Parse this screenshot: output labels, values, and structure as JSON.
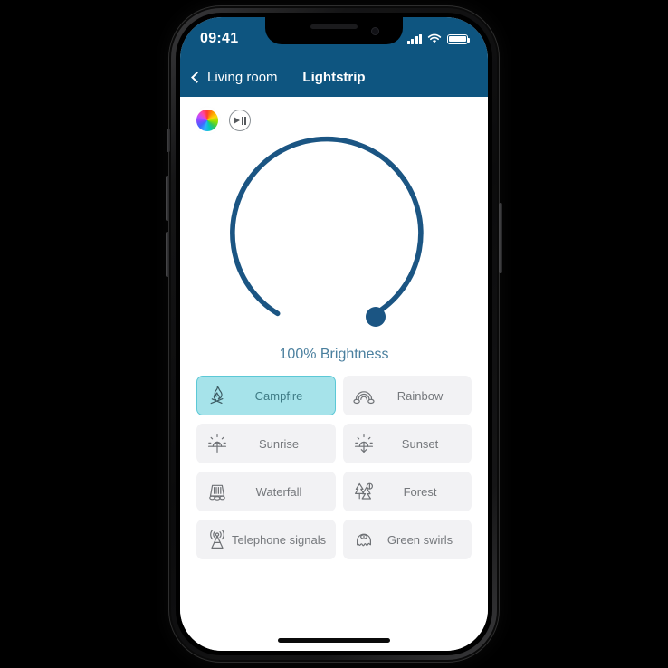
{
  "status_bar": {
    "time": "09:41",
    "signal_icon": "signal-bars-icon",
    "wifi_icon": "wifi-icon",
    "battery_icon": "battery-full-icon"
  },
  "nav": {
    "back_icon": "chevron-left-icon",
    "back_label": "Living room",
    "title": "Lightstrip"
  },
  "quick_actions": {
    "color_wheel_icon": "color-wheel-icon",
    "play_pause_icon": "play-pause-icon"
  },
  "dial": {
    "value_percent": 100,
    "label": "100% Brightness",
    "track_color": "#1b5583",
    "knob_color": "#1b5583",
    "label_color": "#4a7f9e"
  },
  "scenes": {
    "selected_index": 0,
    "items": [
      {
        "label": "Campfire",
        "icon": "campfire-icon",
        "selected": true
      },
      {
        "label": "Rainbow",
        "icon": "rainbow-icon",
        "selected": false
      },
      {
        "label": "Sunrise",
        "icon": "sunrise-icon",
        "selected": false
      },
      {
        "label": "Sunset",
        "icon": "sunset-icon",
        "selected": false
      },
      {
        "label": "Waterfall",
        "icon": "waterfall-icon",
        "selected": false
      },
      {
        "label": "Forest",
        "icon": "forest-icon",
        "selected": false
      },
      {
        "label": "Telephone signals",
        "icon": "telephone-signals-icon",
        "selected": false
      },
      {
        "label": "Green swirls",
        "icon": "green-swirls-icon",
        "selected": false
      }
    ]
  },
  "theme": {
    "header_blue": "#0e5580",
    "selected_scene_bg": "#a6e3ea",
    "selected_scene_border": "#5cc8d6",
    "scene_bg": "#f2f2f4"
  }
}
